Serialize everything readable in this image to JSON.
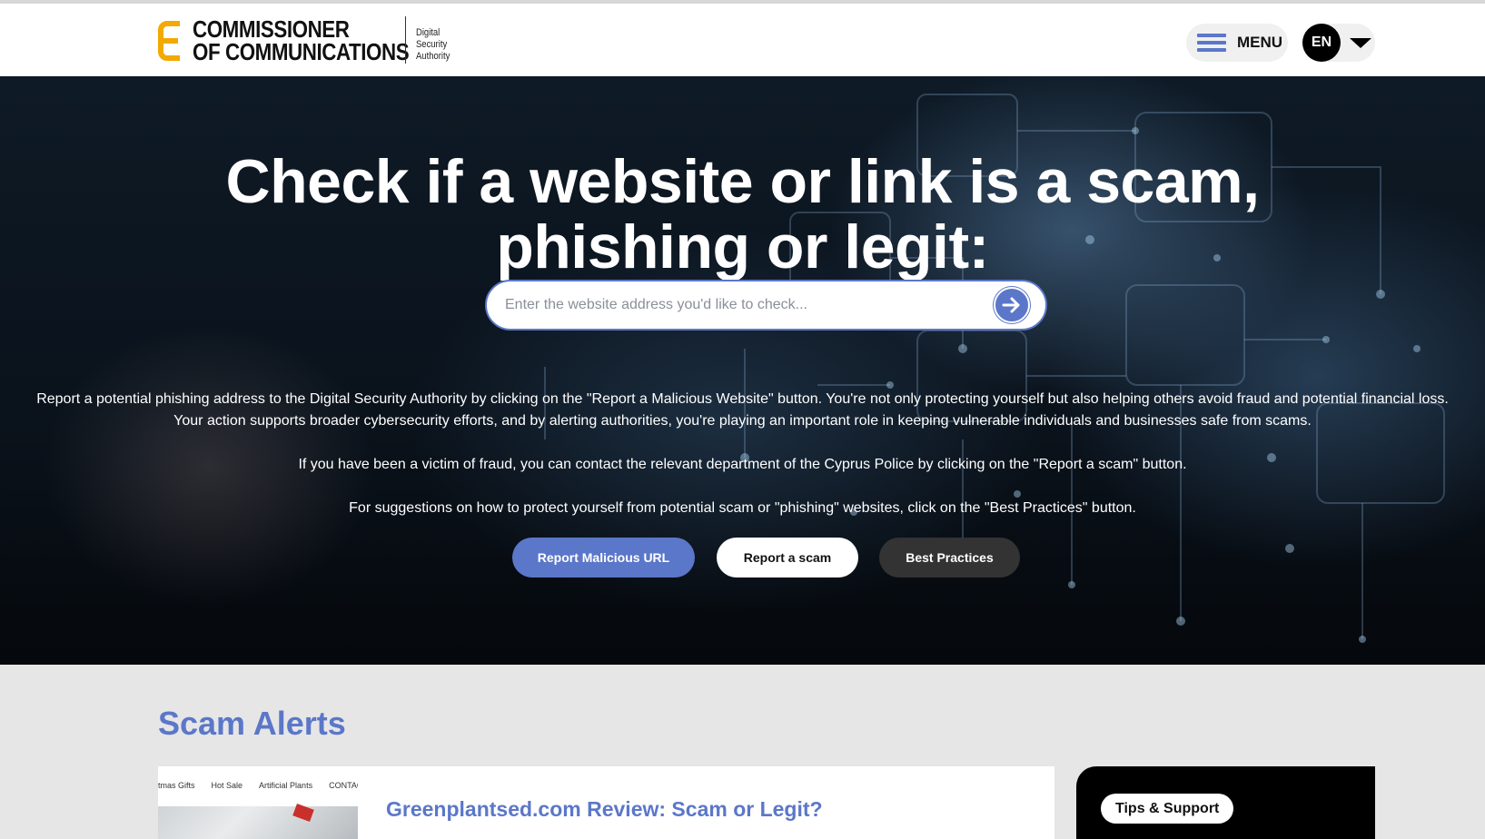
{
  "header": {
    "logo_line1": "COMMISSIONER",
    "logo_line2": "OF COMMUNICATIONS",
    "logo_sub_1": "Digital",
    "logo_sub_2": "Security",
    "logo_sub_3": "Authority",
    "menu_label": "MENU",
    "language": "EN"
  },
  "hero": {
    "title_line1": "Check if a website or link is a scam,",
    "title_line2": "phishing or legit:",
    "search_placeholder": "Enter the website address you'd like to check...",
    "paragraph1_line1": "Report a potential phishing address to the Digital Security Authority by clicking on the \"Report a Malicious Website\" button. You're not only protecting yourself but also helping others avoid fraud and potential financial loss.",
    "paragraph1_line2": "Your action supports broader cybersecurity efforts, and by alerting authorities, you're playing an important role in keeping vulnerable individuals and businesses safe from scams.",
    "paragraph2": "If you have been a victim of fraud, you can contact the relevant department of the Cyprus Police by clicking on the \"Report a scam\" button.",
    "paragraph3": "For suggestions on how to protect yourself from potential scam or \"phishing\" websites, click on the \"Best Practices\" button.",
    "buttons": {
      "report_url": "Report Malicious URL",
      "report_scam": "Report a scam",
      "best_practices": "Best Practices"
    }
  },
  "scam_alerts": {
    "title": "Scam Alerts",
    "card": {
      "thumb_nav": [
        "tmas Gifts",
        "Hot Sale",
        "Artificial Plants",
        "CONTACT"
      ],
      "title": "Greenplantsed.com Review: Scam or Legit?"
    },
    "side_card": {
      "pill": "Tips & Support"
    }
  },
  "colors": {
    "accent": "#5b77c9",
    "logo_yellow": "#f2a900",
    "dark_button": "#333333"
  }
}
